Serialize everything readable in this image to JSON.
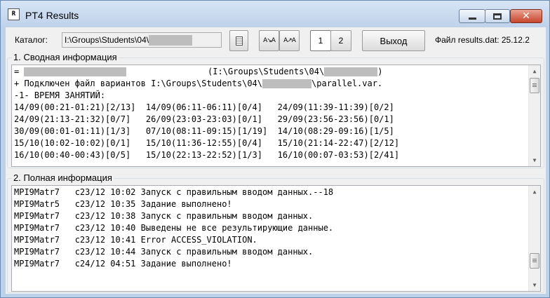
{
  "window": {
    "title": "PT4 Results",
    "app_icon_text": "R",
    "close_glyph": "✕"
  },
  "toolbar": {
    "catalog_label": "Каталог:",
    "catalog_path": "I:\\Groups\\Students\\04\\",
    "tab1_label": "1",
    "tab2_label": "2",
    "exit_label": "Выход",
    "file_info": "Файл results.dat: 25.12.2"
  },
  "summary": {
    "caption": "1. Сводная информация",
    "lines": [
      {
        "prefix": "= ",
        "middle": "                (I:\\Groups\\Students\\04\\",
        "suffix": ")"
      },
      {
        "prefix": "+ Подключен файл вариантов I:\\Groups\\Students\\04\\",
        "middle": "",
        "suffix": "\\parallel.var."
      }
    ],
    "section_title": "-1- ВРЕМЯ ЗАНЯТИЙ:",
    "rows": [
      "14/09(00:21-01:21)[2/13]  14/09(06:11-06:11)[0/4]   24/09(11:39-11:39)[0/2]",
      "24/09(21:13-21:32)[0/7]   26/09(23:03-23:03)[0/1]   29/09(23:56-23:56)[0/1]",
      "30/09(00:01-01:11)[1/3]   07/10(08:11-09:15)[1/19]  14/10(08:29-09:16)[1/5]",
      "15/10(10:02-10:02)[0/1]   15/10(11:36-12:55)[0/4]   15/10(21:14-22:47)[2/12]",
      "16/10(00:40-00:43)[0/5]   15/10(22:13-22:52)[1/3]   16/10(00:07-03:53)[2/41]"
    ]
  },
  "details": {
    "caption": "2. Полная информация",
    "rows": [
      "MPI9Matr7   c23/12 10:02 Запуск с правильным вводом данных.--18",
      "MPI9Matr5   c23/12 10:35 Задание выполнено!",
      "MPI9Matr7   c23/12 10:38 Запуск с правильным вводом данных.",
      "MPI9Matr7   c23/12 10:40 Выведены не все результирующие данные.",
      "MPI9Matr7   c23/12 10:41 Error ACCESS_VIOLATION.",
      "MPI9Matr7   c23/12 10:44 Запуск с правильным вводом данных.",
      "MPI9Matr7   c24/12 04:51 Задание выполнено!"
    ]
  }
}
